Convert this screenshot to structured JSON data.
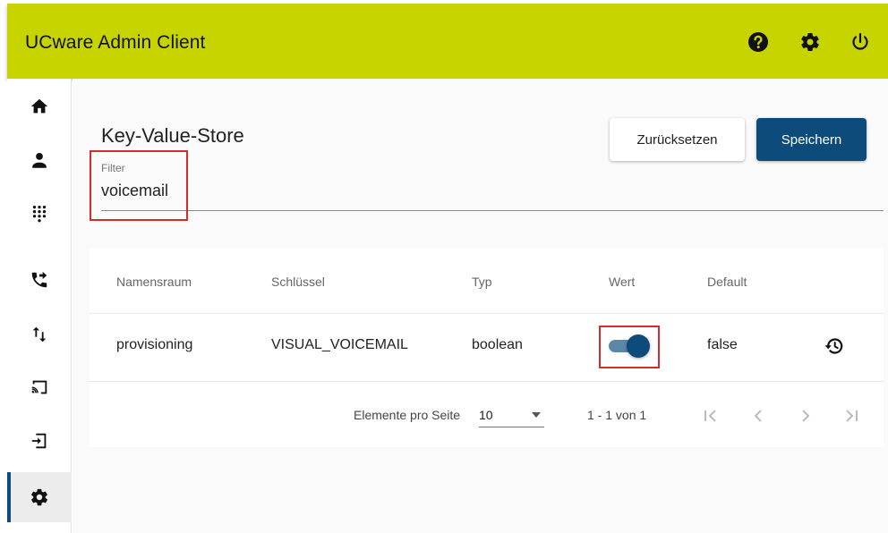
{
  "app": {
    "title": "UCware Admin Client"
  },
  "header_icons": [
    "help-icon",
    "settings-icon",
    "power-icon"
  ],
  "sidebar": {
    "items": [
      {
        "icon": "home-icon",
        "active": false
      },
      {
        "icon": "person-icon",
        "active": false
      },
      {
        "icon": "dialpad-icon",
        "active": false
      },
      {
        "icon": "call-forward-icon",
        "active": false
      },
      {
        "icon": "import-export-icon",
        "active": false
      },
      {
        "icon": "cast-icon",
        "active": false
      },
      {
        "icon": "login-icon",
        "active": false
      },
      {
        "icon": "settings-icon",
        "active": true
      }
    ]
  },
  "page": {
    "title": "Key-Value-Store",
    "filter": {
      "label": "Filter",
      "value": "voicemail"
    },
    "buttons": {
      "reset": "Zurücksetzen",
      "save": "Speichern"
    }
  },
  "table": {
    "columns": [
      "Namensraum",
      "Schlüssel",
      "Typ",
      "Wert",
      "Default"
    ],
    "rows": [
      {
        "namespace": "provisioning",
        "key": "VISUAL_VOICEMAIL",
        "type": "boolean",
        "value": true,
        "default": "false"
      }
    ]
  },
  "paginator": {
    "items_per_page_label": "Elemente pro Seite",
    "page_size": "10",
    "range": "1 - 1 von 1"
  },
  "colors": {
    "header": "#c8d400",
    "primary": "#0c4b7a",
    "highlight": "#d52b2b"
  }
}
